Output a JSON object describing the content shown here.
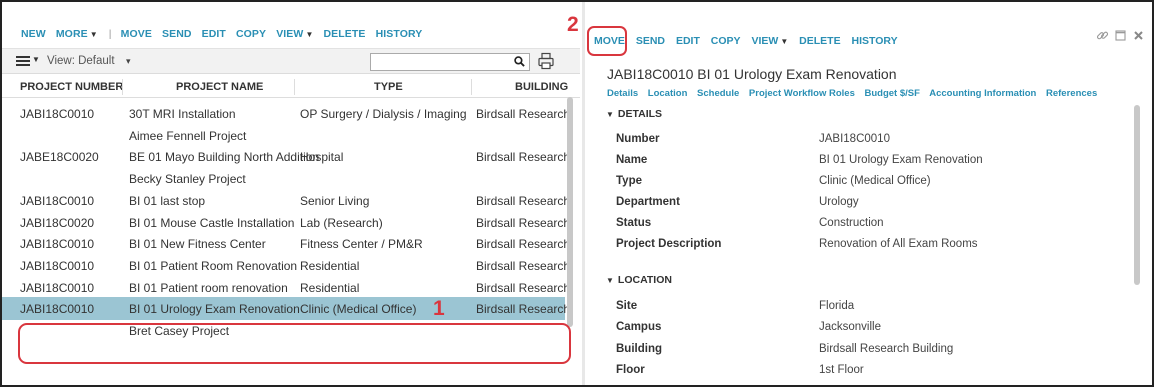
{
  "left": {
    "toolbar": [
      "NEW",
      "MORE",
      "MOVE",
      "SEND",
      "EDIT",
      "COPY",
      "VIEW",
      "DELETE",
      "HISTORY"
    ],
    "view_label": "View: Default",
    "search": {
      "value": "",
      "placeholder": ""
    },
    "columns": [
      "PROJECT NUMBER",
      "PROJECT NAME",
      "TYPE",
      "BUILDING"
    ],
    "rows": [
      {
        "number": "JABI18C0010",
        "name": "30T MRI Installation",
        "type": "OP Surgery / Dialysis / Imaging",
        "building": "Birdsall Research"
      },
      {
        "number": "",
        "name": "Aimee Fennell Project",
        "type": "",
        "building": ""
      },
      {
        "number": "JABE18C0020",
        "name": "BE 01 Mayo Building North Addition",
        "type": "Hospital",
        "building": "Birdsall Research"
      },
      {
        "number": "",
        "name": "Becky Stanley Project",
        "type": "",
        "building": ""
      },
      {
        "number": "JABI18C0010",
        "name": "BI 01 last stop",
        "type": "Senior Living",
        "building": "Birdsall Research"
      },
      {
        "number": "JABI18C0020",
        "name": "BI 01 Mouse Castle Installation",
        "type": "Lab (Research)",
        "building": "Birdsall Research"
      },
      {
        "number": "JABI18C0010",
        "name": "BI 01 New Fitness Center",
        "type": "Fitness Center / PM&R",
        "building": "Birdsall Research"
      },
      {
        "number": "JABI18C0010",
        "name": "BI 01 Patient Room Renovation",
        "type": "Residential",
        "building": "Birdsall Research"
      },
      {
        "number": "JABI18C0010",
        "name": "BI 01 Patient room renovation",
        "type": "Residential",
        "building": "Birdsall Research"
      },
      {
        "number": "JABI18C0010",
        "name": "BI 01 Urology Exam Renovation",
        "type": "Clinic (Medical Office)",
        "building": "Birdsall Research"
      },
      {
        "number": "",
        "name": "Bret Casey Project",
        "type": "",
        "building": ""
      }
    ],
    "selected_index": 9,
    "callout": "1"
  },
  "right": {
    "toolbar": [
      "MOVE",
      "SEND",
      "EDIT",
      "COPY",
      "VIEW",
      "DELETE",
      "HISTORY"
    ],
    "callout": "2",
    "title": "JABI18C0010 BI 01 Urology Exam Renovation",
    "tabs": [
      "Details",
      "Location",
      "Schedule",
      "Project Workflow Roles",
      "Budget $/SF",
      "Accounting Information",
      "References"
    ],
    "details_header": "DETAILS",
    "details": [
      {
        "label": "Number",
        "value": "JABI18C0010"
      },
      {
        "label": "Name",
        "value": "BI 01 Urology Exam Renovation"
      },
      {
        "label": "Type",
        "value": "Clinic (Medical Office)"
      },
      {
        "label": "Department",
        "value": "Urology"
      },
      {
        "label": "Status",
        "value": "Construction"
      },
      {
        "label": "Project Description",
        "value": "Renovation of All Exam Rooms"
      }
    ],
    "location_header": "LOCATION",
    "location": [
      {
        "label": "Site",
        "value": "Florida"
      },
      {
        "label": "Campus",
        "value": "Jacksonville"
      },
      {
        "label": "Building",
        "value": "Birdsall Research Building"
      },
      {
        "label": "Floor",
        "value": "1st Floor"
      }
    ]
  },
  "colors": {
    "accent": "#2a8fb4",
    "selected_row": "#9bc5d3",
    "callout": "#d9363e"
  }
}
